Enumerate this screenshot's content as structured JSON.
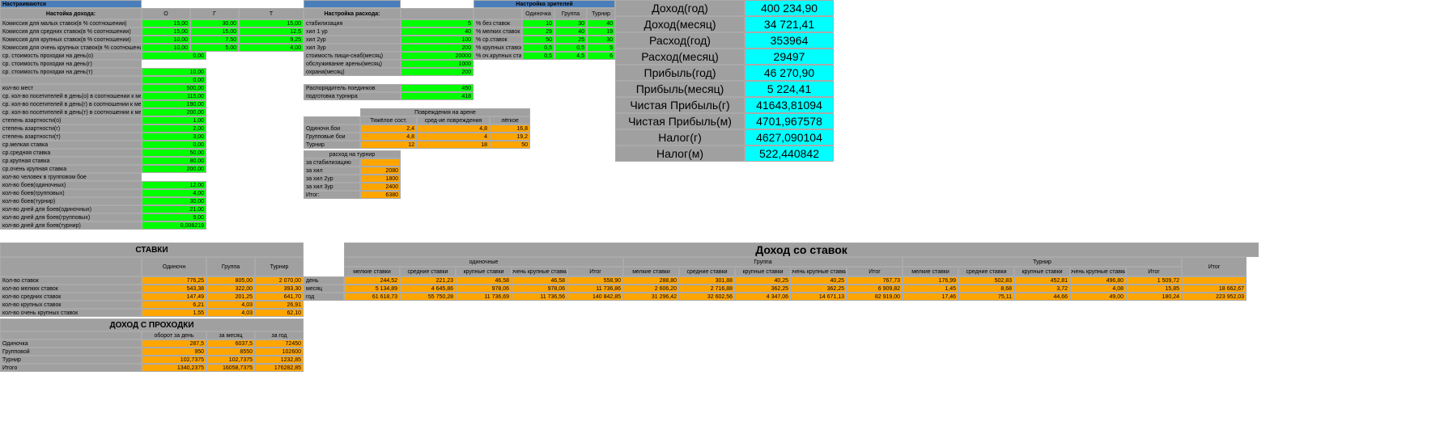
{
  "top": {
    "настраиваетсяLabel": "Настраиваются",
    "настройкаДоходаLabel": "Настойка дохода:",
    "cols": [
      "О",
      "Г",
      "Т"
    ],
    "настройкаРасходаLabel": "Настройка расхода:",
    "настройкаЗрителейLabel": "Настройка зрителей",
    "зрителиCols": [
      "Одиночка",
      "Группа",
      "Турнир"
    ],
    "rows": [
      {
        "label": "Комиссия для малых ставок(в % соотношении)",
        "o": "15,00",
        "g": "30,00",
        "t": "15,00",
        "r_label": "стабилизация",
        "r_val": "5",
        "z_label": "% без ставок",
        "z_o": "10",
        "z_g": "30",
        "z_t": "40"
      },
      {
        "label": "Комиссия для средних ставок(в % соотношении)",
        "o": "15,00",
        "g": "15,00",
        "t": "12,5",
        "r_label": "хил 1 ур",
        "r_val": "40",
        "z_label": "% мелких ставок",
        "z_o": "29",
        "z_g": "40",
        "z_t": "19"
      },
      {
        "label": "Комиссия для крупных ставок(в % соотношении)",
        "o": "10,00",
        "g": "7,50",
        "t": "9,25",
        "r_label": "хил 2ур",
        "r_val": "100",
        "z_label": "% ср.ставок",
        "z_o": "50",
        "z_g": "25",
        "z_t": "30"
      },
      {
        "label": "Комиссия для очень крупных ставок(в % соотношении)",
        "o": "10,00",
        "g": "5,00",
        "t": "4,00",
        "r_label": "хил 3ур",
        "r_val": "200",
        "z_label": "% крупных ставок",
        "z_o": "0,5",
        "z_g": "0,5",
        "z_t": "5"
      },
      {
        "label": "ср. стоимость проходки на день(о)",
        "o": "",
        "g": "0,00",
        "t": "",
        "r_label": "стоимость пищи-снаб(месяц)",
        "r_val": "20000",
        "z_label": "% оч.крупных ставок",
        "z_o": "0,5",
        "z_g": "4,5",
        "z_t": "6"
      },
      {
        "label": "ср. стоимость проходки на день(г)",
        "o": "",
        "g": "",
        "t": "",
        "r_label": "обслуживание арены(месяц)",
        "r_val": "1000",
        "z_label": "",
        "z_o": "",
        "z_g": "",
        "z_t": ""
      },
      {
        "label": "ср. стоимость проходки на день(т)",
        "o": "",
        "g": "10,00",
        "t": "",
        "r_label": "охрана(месяц)",
        "r_val": "200",
        "z_label": "",
        "z_o": "",
        "z_g": "",
        "z_t": ""
      },
      {
        "label": "",
        "o": "",
        "g": "0,00",
        "t": "",
        "r_label": "",
        "r_val": "",
        "z_label": "",
        "z_o": "",
        "z_g": "",
        "z_t": ""
      },
      {
        "label": "кол-во мест",
        "o": "",
        "g": "500,00",
        "t": "",
        "r_label": "Распорядитель поединков",
        "r_val": "450",
        "z_label": "",
        "z_o": "",
        "z_g": "",
        "z_t": ""
      },
      {
        "label": "ср. кол-во посетителей в день(о) в соотношении к местам(%)",
        "o": "",
        "g": "115,00",
        "t": "",
        "r_label": "подготовка турнира",
        "r_val": "418",
        "z_label": "",
        "z_o": "",
        "z_g": "",
        "z_t": ""
      },
      {
        "label": "ср. кол-во посетителей в день(г) в соотношении к местам (%)",
        "o": "",
        "g": "190,00",
        "t": "",
        "r_label": "",
        "r_val": "",
        "z_label": "",
        "z_o": "",
        "z_g": "",
        "z_t": ""
      },
      {
        "label": "ср. кол-во посетителей в день(т) в соотношении к местам(%)",
        "o": "",
        "g": "200,00",
        "t": "",
        "r_label": "",
        "r_val": "",
        "z_label": "",
        "z_o": "",
        "z_g": "",
        "z_t": ""
      },
      {
        "label": "степень азартности(о)",
        "o": "",
        "g": "1,00",
        "t": "",
        "r_label": "",
        "r_val": "",
        "z_label": "",
        "z_o": "",
        "z_g": "",
        "z_t": ""
      },
      {
        "label": "степень азартности(г)",
        "o": "",
        "g": "2,00",
        "t": "",
        "r_label": "",
        "r_val": "",
        "z_label": "",
        "z_o": "",
        "z_g": "",
        "z_t": ""
      },
      {
        "label": "степень азартности(т)",
        "o": "",
        "g": "3,00",
        "t": "",
        "r_label": "",
        "r_val": "",
        "z_label": "",
        "z_o": "",
        "z_g": "",
        "z_t": ""
      },
      {
        "label": "ср.мелкая ставка",
        "o": "",
        "g": "0,00",
        "t": "",
        "r_label": "",
        "r_val": "",
        "z_label": "",
        "z_o": "",
        "z_g": "",
        "z_t": ""
      },
      {
        "label": "ср.средняя ставка",
        "o": "",
        "g": "50,00",
        "t": "",
        "r_label": "",
        "r_val": "",
        "z_label": "",
        "z_o": "",
        "z_g": "",
        "z_t": ""
      },
      {
        "label": "ср.крупная ставка",
        "o": "",
        "g": "80,00",
        "t": "",
        "r_label": "",
        "r_val": "",
        "z_label": "",
        "z_o": "",
        "z_g": "",
        "z_t": ""
      },
      {
        "label": "ср.очень крупная ставка",
        "o": "",
        "g": "200,00",
        "t": "",
        "r_label": "",
        "r_val": "",
        "z_label": "",
        "z_o": "",
        "z_g": "",
        "z_t": ""
      },
      {
        "label": "кол-во человек в групповом бое",
        "o": "",
        "g": "",
        "t": "",
        "r_label": "",
        "r_val": "",
        "z_label": "",
        "z_o": "",
        "z_g": "",
        "z_t": ""
      },
      {
        "label": "кол-во боев(одиночных)",
        "o": "",
        "g": "12,00",
        "t": "",
        "r_label": "",
        "r_val": "",
        "z_label": "",
        "z_o": "",
        "z_g": "",
        "z_t": ""
      },
      {
        "label": "кол-во боев(групповых)",
        "o": "",
        "g": "4,00",
        "t": "",
        "r_label": "",
        "r_val": "",
        "z_label": "",
        "z_o": "",
        "z_g": "",
        "z_t": ""
      },
      {
        "label": "кол-во боев(турнир)",
        "o": "",
        "g": "30,00",
        "t": "",
        "r_label": "",
        "r_val": "",
        "z_label": "",
        "z_o": "",
        "z_g": "",
        "z_t": ""
      },
      {
        "label": "кол-во дней для боев(одиночных)",
        "o": "",
        "g": "21,00",
        "t": "",
        "r_label": "",
        "r_val": "",
        "z_label": "",
        "z_o": "",
        "z_g": "",
        "z_t": ""
      },
      {
        "label": "кол-во дней для боев(групповых)",
        "o": "",
        "g": "9,00",
        "t": "",
        "r_label": "",
        "r_val": "",
        "z_label": "",
        "z_o": "",
        "z_g": "",
        "z_t": ""
      },
      {
        "label": "кол-во дней для боев(турнир)",
        "o": "",
        "g": "0,008219",
        "t": "",
        "r_label": "",
        "r_val": "",
        "z_label": "",
        "z_o": "",
        "z_g": "",
        "z_t": ""
      }
    ]
  },
  "damage": {
    "title": "Повреждения на арене",
    "cols": [
      "",
      "Тяжёлое сост.",
      "сред-ие повреждения",
      "лёгкое"
    ],
    "rows": [
      {
        "label": "Одиночн.бои",
        "a": "2,4",
        "b": "4,8",
        "c": "16,8"
      },
      {
        "label": "Групповые бои",
        "a": "4,8",
        "b": "4",
        "c": "19,2"
      },
      {
        "label": "Турнир",
        "a": "12",
        "b": "18",
        "c": "50"
      }
    ]
  },
  "tournExpense": {
    "title": "расход на турнир",
    "rows": [
      {
        "label": "за стабилизацию",
        "val": ""
      },
      {
        "label": "за хил",
        "val": "2080"
      },
      {
        "label": "за хил 2ур",
        "val": "1800"
      },
      {
        "label": "за хил 3ур",
        "val": "2400"
      },
      {
        "label": "Итог:",
        "val": "6380"
      }
    ]
  },
  "summary": [
    {
      "label": "Доход(год)",
      "val": "400 234,90"
    },
    {
      "label": "Доход(месяц)",
      "val": "34 721,41"
    },
    {
      "label": "Расход(год)",
      "val": "353964"
    },
    {
      "label": "Расход(месяц)",
      "val": "29497"
    },
    {
      "label": "Прибыль(год)",
      "val": "46 270,90"
    },
    {
      "label": "Прибыль(месяц)",
      "val": "5 224,41"
    },
    {
      "label": "Чистая Прибыль(г)",
      "val": "41643,81094"
    },
    {
      "label": "Чистая Прибыль(м)",
      "val": "4701,967578"
    },
    {
      "label": "Налог(г)",
      "val": "4627,090104"
    },
    {
      "label": "Налог(м)",
      "val": "522,440842"
    }
  ],
  "stakes": {
    "title": "СТАВКИ",
    "cols": [
      "",
      "Одиночн",
      "Группа",
      "Турнир"
    ],
    "periodLabels": [
      "день",
      "месяц",
      "год"
    ],
    "rows": [
      {
        "label": "Кол-во ставок",
        "o": "776,25",
        "g": "805,00",
        "t": "2 070,00"
      },
      {
        "label": "кол-во мелких ставок",
        "o": "543,38",
        "g": "322,00",
        "t": "393,30"
      },
      {
        "label": "кол-во средних ставок",
        "o": "147,49",
        "g": "201,25",
        "t": "641,70"
      },
      {
        "label": "кол-во крупных ставок",
        "o": "6,21",
        "g": "4,03",
        "t": "26,91"
      },
      {
        "label": "кол-во очень крупных ставок",
        "o": "1,55",
        "g": "4,03",
        "t": "62,10"
      }
    ]
  },
  "income": {
    "title": "Доход со ставок",
    "groups": [
      "одиночные",
      "Группа",
      "Турнир"
    ],
    "subcols": [
      "мелкие ставки",
      "средние ставки",
      "крупные ставки",
      "очень крупные ставки",
      "Итог"
    ],
    "totalLabel": "Итог",
    "rows": [
      [
        "244,52",
        "221,23",
        "46,58",
        "46,58",
        "558,90",
        "288,80",
        "301,88",
        "40,25",
        "40,25",
        "767,73",
        "176,99",
        "502,83",
        "452,81",
        "496,80",
        "1 509,72",
        ""
      ],
      [
        "5 134,89",
        "4 645,86",
        "978,06",
        "978,06",
        "11 736,86",
        "2 606,20",
        "2 716,88",
        "362,25",
        "362,25",
        "6 909,82",
        "1,45",
        "8,68",
        "3,72",
        "4,08",
        "15,85",
        "18 662,67"
      ],
      [
        "61 618,73",
        "55 750,28",
        "11 736,69",
        "11 736,56",
        "140 842,85",
        "31 296,42",
        "32 602,56",
        "4 347,06",
        "14 671,13",
        "82 919,00",
        "17,46",
        "75,11",
        "44,66",
        "49,00",
        "180,24",
        "223 952,03"
      ]
    ]
  },
  "entry": {
    "title": "ДОХОД С ПРОХОДКИ",
    "cols": [
      "",
      "оборот за день",
      "за месяц",
      "за год"
    ],
    "rows": [
      {
        "label": "Одиночка",
        "a": "287,5",
        "b": "6037,5",
        "c": "72450"
      },
      {
        "label": "Групповой",
        "a": "950",
        "b": "8550",
        "c": "102600"
      },
      {
        "label": "Турнир",
        "a": "102,7375",
        "b": "102,7375",
        "c": "1232,85"
      },
      {
        "label": "Итого",
        "a": "1340,2375",
        "b": "16058,7375",
        "c": "176282,85"
      }
    ]
  }
}
